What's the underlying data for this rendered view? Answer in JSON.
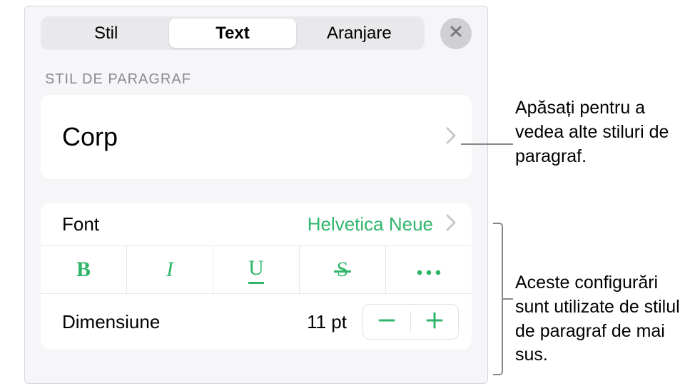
{
  "tabs": {
    "style": "Stil",
    "text": "Text",
    "arrange": "Aranjare"
  },
  "section_header": "STIL DE PARAGRAF",
  "paragraph_style": {
    "current": "Corp"
  },
  "font": {
    "label": "Font",
    "value": "Helvetica Neue"
  },
  "size": {
    "label": "Dimensiune",
    "value": "11 pt"
  },
  "callouts": {
    "paragraph": "Apăsați pentru a vedea alte stiluri de paragraf.",
    "font_settings": "Aceste configurări sunt utilizate de stilul de paragraf de mai sus."
  }
}
